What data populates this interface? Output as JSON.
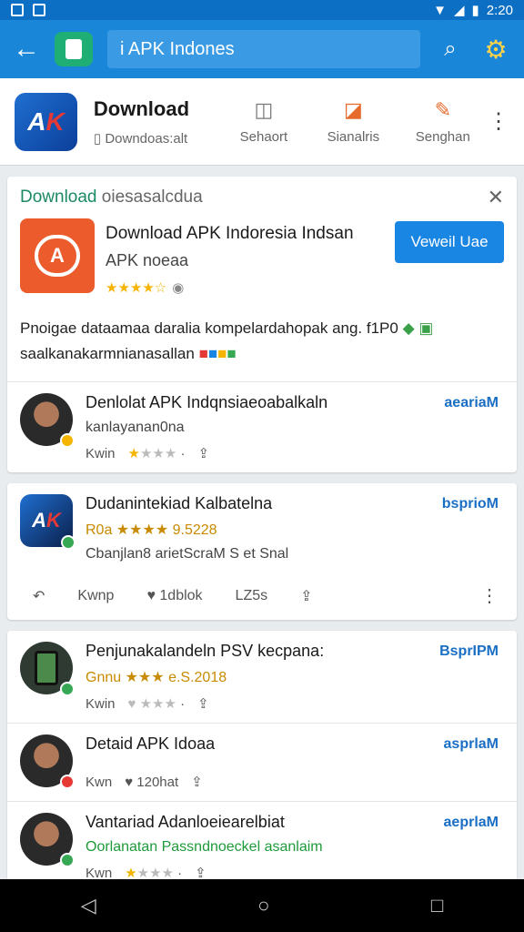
{
  "status": {
    "time": "2:20"
  },
  "search": {
    "query": "i APK Indones"
  },
  "header": {
    "title": "Download",
    "subtitle": "Downdoas:alt",
    "cols": [
      "Sehaort",
      "Sianalris",
      "Senghan"
    ]
  },
  "promo": {
    "label_a": "Download",
    "label_b": "oiesasalcdua",
    "app_name": "Download APK Indoresia Indsan",
    "app_sub": "APK noeaa",
    "stars": "★★★★☆",
    "install_label": "Veweil Uae",
    "desc_line1": "Pnoigae dataamaa daralia kompelardahopak ang. f1P0",
    "desc_line2": "saalkanakarmnianasallan"
  },
  "rows_card1": [
    {
      "title": "Denlolat APK Indqnsiaeoabalkaln",
      "sub": "kanlayanan0na",
      "meta_a": "Kwin",
      "action": "aeariaM"
    }
  ],
  "card2": {
    "title": "Dudanintekiad Kalbatelna",
    "rating": "R0a ★★★★ 9.5228",
    "sub": "Cbanjlan8 arietScraM  S et Snal",
    "action": "bsprioM",
    "actions": [
      "Kwnp",
      "1dblok",
      "LZ5s"
    ]
  },
  "rows_card3": [
    {
      "title": "Penjunakalandeln PSV kecpana:",
      "sub": "Gnnu ★★★ e.S.2018",
      "meta_a": "Kwin",
      "meta_b": "",
      "action": "BsprIPM"
    },
    {
      "title": "Detaid APK Idoaa",
      "sub": "",
      "meta_a": "Kwn",
      "meta_b": "120hat",
      "action": "asprlaM"
    },
    {
      "title": "Vantariad Adanloeiearelbiat",
      "sub": "Oorlanatan Passndnoeckel asanlaim",
      "meta_a": "Kwn",
      "meta_b": "",
      "action": "aeprlaM"
    }
  ]
}
